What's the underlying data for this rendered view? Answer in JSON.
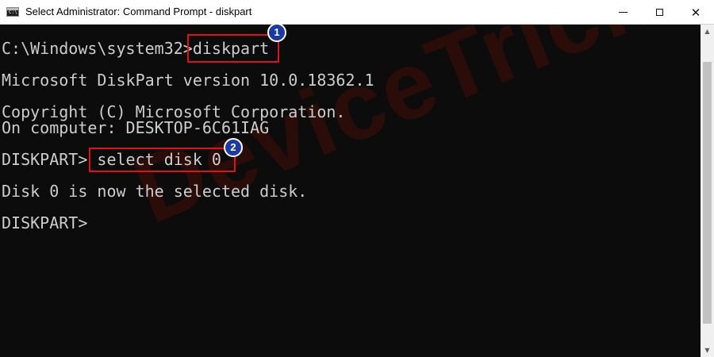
{
  "window": {
    "title": "Select Administrator: Command Prompt - diskpart",
    "app_icon_text": "C:\\",
    "minimize_icon": "minimize-icon",
    "maximize_icon": "maximize-icon",
    "close_glyph": "✕"
  },
  "console": {
    "lines": [
      "C:\\Windows\\system32>diskpart",
      "Microsoft DiskPart version 10.0.18362.1",
      "Copyright (C) Microsoft Corporation.",
      "On computer: DESKTOP-6C61IAG",
      "DISKPART> select disk 0",
      "Disk 0 is now the selected disk.",
      "DISKPART>"
    ]
  },
  "annotations": {
    "step1": "1",
    "step2": "2",
    "highlight_color": "#e0101a",
    "badge_color": "#1a3aa8"
  },
  "watermark": "DeviceTricks",
  "scrollbar": {
    "up_glyph": "▲",
    "down_glyph": "▼"
  },
  "colors": {
    "console_bg": "#0c0c0c",
    "console_text": "#cccccc"
  }
}
